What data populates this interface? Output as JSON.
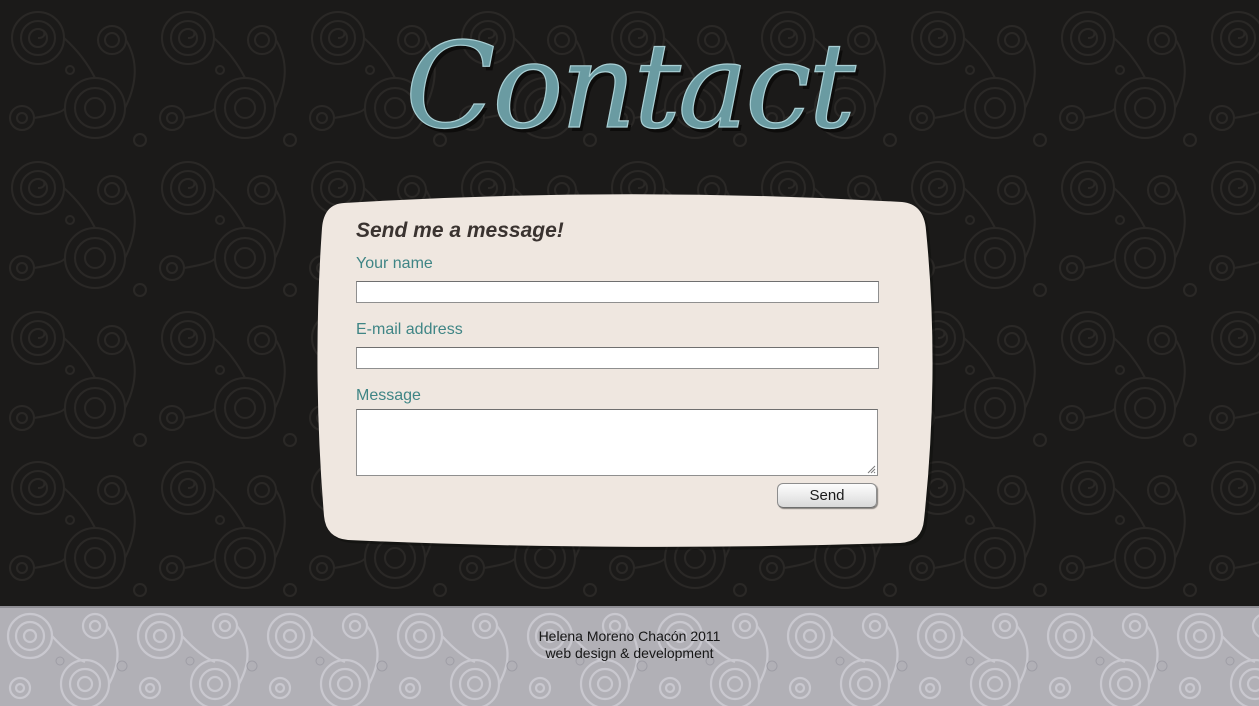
{
  "page": {
    "title": "Contact"
  },
  "form": {
    "heading": "Send me a message!",
    "name_label": "Your name",
    "name_value": "",
    "email_label": "E-mail address",
    "email_value": "",
    "message_label": "Message",
    "message_value": "",
    "send_label": "Send"
  },
  "footer": {
    "line1": "Helena Moreno Chacón 2011",
    "line2": "web design & development"
  },
  "colors": {
    "background": "#1b1a19",
    "title": "#6a9ba2",
    "card": "#efe7e0",
    "label": "#3f8585",
    "footer_bg": "#b1b0b6"
  },
  "icons": {
    "background_pattern": "swirl-pattern",
    "resize_grip": "resize-grip-icon"
  }
}
